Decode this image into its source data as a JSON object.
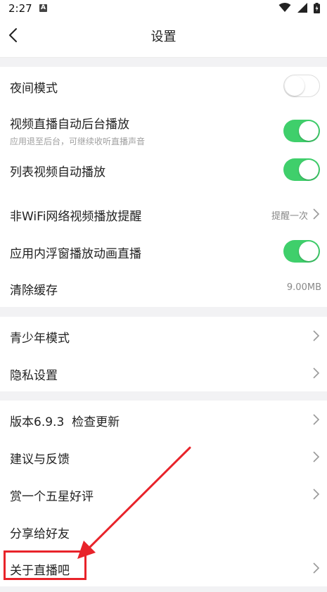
{
  "status": {
    "time": "2:27",
    "notif_glyph": "A"
  },
  "header": {
    "title": "设置"
  },
  "group1": [
    {
      "label": "夜间模式",
      "control": "toggle",
      "on": false
    },
    {
      "label": "视频直播自动后台播放",
      "sub": "应用退至后台，可继续收听直播声音",
      "control": "toggle",
      "on": true
    },
    {
      "label": "列表视频自动播放",
      "control": "toggle",
      "on": true
    },
    {
      "label": "非WiFi网络视频播放提醒",
      "value": "提醒一次",
      "control": "chevron"
    },
    {
      "label": "应用内浮窗播放动画直播",
      "control": "toggle",
      "on": true
    },
    {
      "label": "清除缓存",
      "value": "9.00MB",
      "control": "none"
    }
  ],
  "group2": [
    {
      "label": "青少年模式"
    },
    {
      "label": "隐私设置"
    }
  ],
  "group3": [
    {
      "label": "版本6.9.3  检查更新"
    },
    {
      "label": "建议与反馈"
    },
    {
      "label": "赏一个五星好评"
    },
    {
      "label": "分享给好友"
    },
    {
      "label": "关于直播吧"
    }
  ],
  "colors": {
    "toggle_on": "#3fcf6b",
    "annotation": "#e8232a"
  }
}
